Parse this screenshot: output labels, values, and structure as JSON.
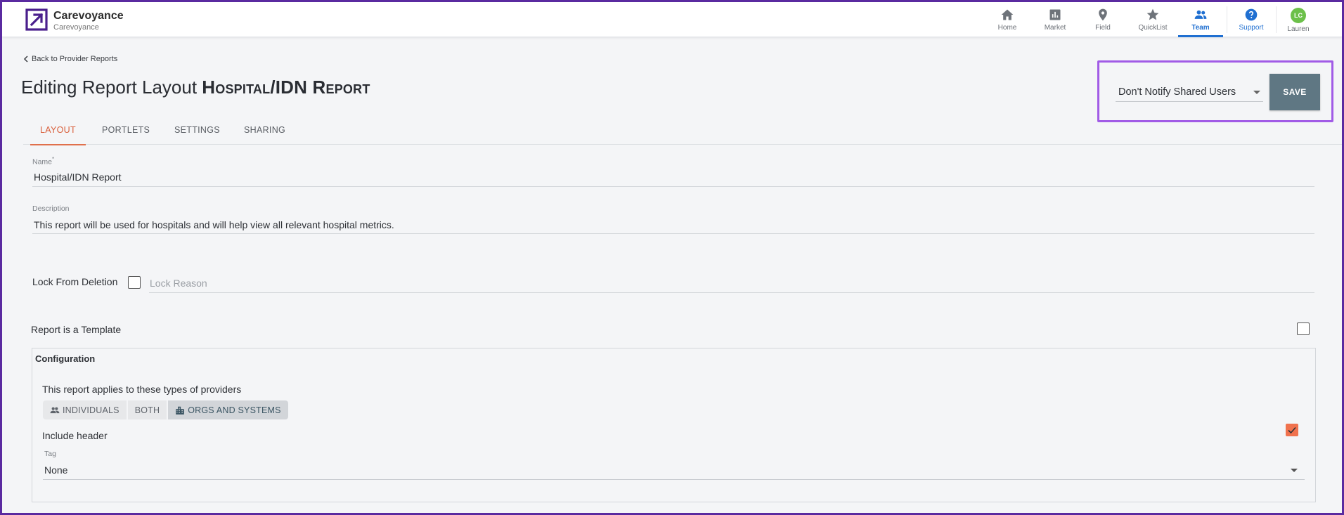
{
  "app": {
    "brand_name": "Carevoyance",
    "brand_sub": "Carevoyance"
  },
  "nav": {
    "items": [
      {
        "label": "Home",
        "icon": "home-icon"
      },
      {
        "label": "Market",
        "icon": "chart-icon"
      },
      {
        "label": "Field",
        "icon": "map-pin-icon"
      },
      {
        "label": "QuickList",
        "icon": "star-icon"
      },
      {
        "label": "Team",
        "icon": "team-icon",
        "active": true
      },
      {
        "label": "Support",
        "icon": "help-icon"
      },
      {
        "label": "Lauren",
        "icon": "avatar",
        "initials": "LC"
      }
    ]
  },
  "page": {
    "back_link": "Back to Provider Reports",
    "title_prefix": "Editing Report Layout",
    "title_name": "Hospital/IDN Report"
  },
  "actions": {
    "notify_select": "Don't Notify Shared Users",
    "save_label": "SAVE"
  },
  "tabs": [
    "LAYOUT",
    "PORTLETS",
    "SETTINGS",
    "SHARING"
  ],
  "active_tab": "LAYOUT",
  "form": {
    "name_label": "Name",
    "name_required_mark": "*",
    "name_value": "Hospital/IDN Report",
    "description_label": "Description",
    "description_value": "This report will be used for hospitals and will help view all relevant hospital metrics.",
    "lock_label": "Lock From Deletion",
    "lock_checked": false,
    "lock_reason_placeholder": "Lock Reason",
    "template_label": "Report is a Template",
    "template_checked": false
  },
  "configuration": {
    "title": "Configuration",
    "provider_types_label": "This report applies to these types of providers",
    "provider_types": [
      {
        "label": "INDIVIDUALS",
        "icon": "people-icon",
        "selected": false
      },
      {
        "label": "BOTH",
        "icon": "",
        "selected": false
      },
      {
        "label": "ORGS AND SYSTEMS",
        "icon": "building-icon",
        "selected": true
      }
    ],
    "include_header_label": "Include header",
    "include_header_checked": true,
    "tag_label": "Tag",
    "tag_value": "None"
  },
  "colors": {
    "frame": "#5a2aa0",
    "accent": "#1f6fd1",
    "tab_active": "#e0704c",
    "save_button": "#5f7783",
    "highlight_box": "#a15be6",
    "checkbox_checked": "#f0724e"
  }
}
